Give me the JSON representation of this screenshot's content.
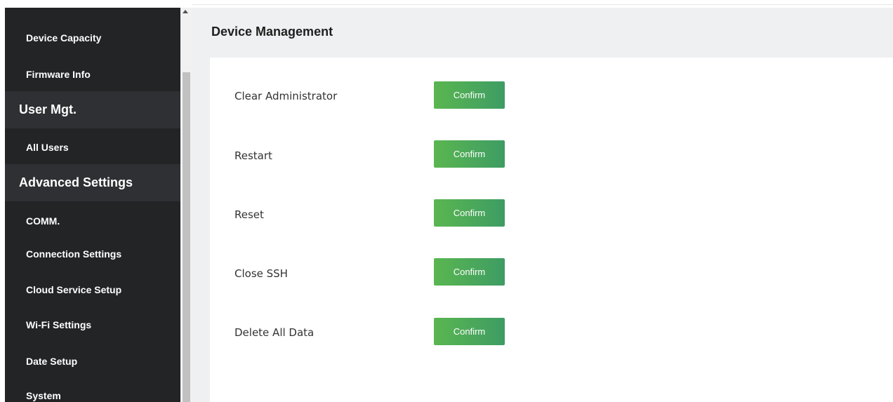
{
  "sidebar": {
    "items": [
      {
        "type": "item",
        "label": "Device Capacity"
      },
      {
        "type": "item",
        "label": "Firmware Info"
      },
      {
        "type": "group",
        "label": "User Mgt."
      },
      {
        "type": "item",
        "label": "All Users"
      },
      {
        "type": "group",
        "label": "Advanced Settings"
      },
      {
        "type": "item",
        "label": "COMM."
      },
      {
        "type": "item",
        "label": "Connection Settings"
      },
      {
        "type": "item",
        "label": "Cloud Service Setup"
      },
      {
        "type": "item",
        "label": "Wi-Fi Settings"
      },
      {
        "type": "item",
        "label": "Date Setup"
      },
      {
        "type": "item",
        "label": "System"
      }
    ]
  },
  "main": {
    "title": "Device Management",
    "rows": [
      {
        "label": "Clear Administrator",
        "button": "Confirm"
      },
      {
        "label": "Restart",
        "button": "Confirm"
      },
      {
        "label": "Reset",
        "button": "Confirm"
      },
      {
        "label": "Close SSH",
        "button": "Confirm"
      },
      {
        "label": "Delete All Data",
        "button": "Confirm"
      }
    ]
  },
  "colors": {
    "sidebar_bg": "#222426",
    "sidebar_group_bg": "#2e3033",
    "panel_bg": "#eef0f1",
    "button_start": "#5ab650",
    "button_end": "#3e9c64"
  }
}
